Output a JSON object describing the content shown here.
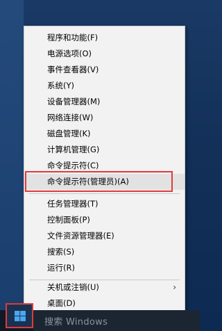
{
  "menu": {
    "items": [
      {
        "label": "程序和功能(F)"
      },
      {
        "label": "电源选项(O)"
      },
      {
        "label": "事件查看器(V)"
      },
      {
        "label": "系统(Y)"
      },
      {
        "label": "设备管理器(M)"
      },
      {
        "label": "网络连接(W)"
      },
      {
        "label": "磁盘管理(K)"
      },
      {
        "label": "计算机管理(G)"
      },
      {
        "label": "命令提示符(C)"
      },
      {
        "label": "命令提示符(管理员)(A)"
      },
      {
        "label": "任务管理器(T)"
      },
      {
        "label": "控制面板(P)"
      },
      {
        "label": "文件资源管理器(E)"
      },
      {
        "label": "搜索(S)"
      },
      {
        "label": "运行(R)"
      },
      {
        "label": "关机或注销(U)"
      },
      {
        "label": "桌面(D)"
      }
    ],
    "submenu_arrow": "›"
  },
  "taskbar": {
    "search_placeholder": "搜索 Windows"
  },
  "colors": {
    "highlight_box": "#e03a3a",
    "menu_background": "#f2f2f2",
    "taskbar": "#101a26"
  }
}
